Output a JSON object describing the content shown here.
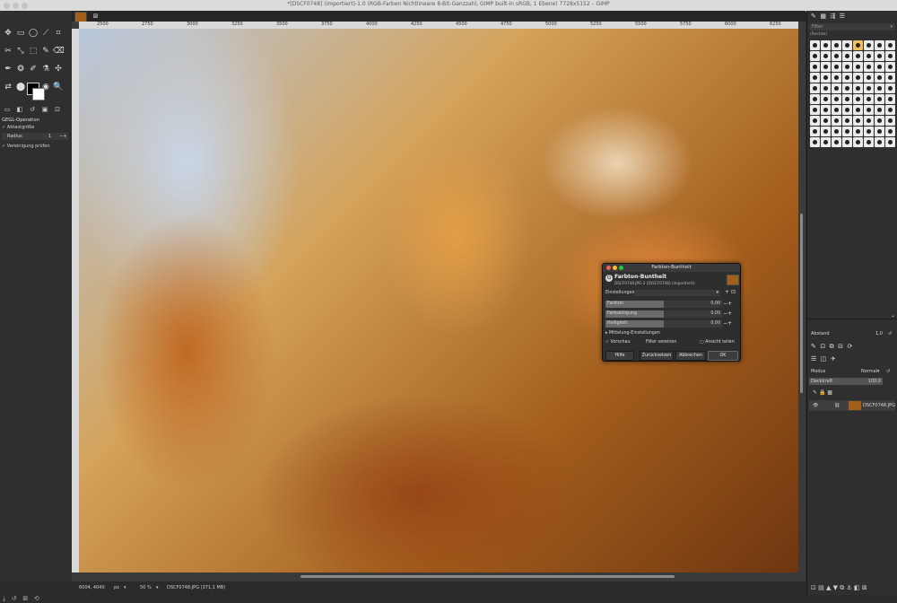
{
  "window": {
    "title": "*[DSCF0748] (importiert)-1.0 (RGB-Farben Nichtlineare 8-Bit-Ganzzahl, GIMP built-in sRGB, 1 Ebene) 7728x5152 – GIMP"
  },
  "toolbox": {
    "tools": [
      "✥",
      "▭",
      "◯",
      "⟋",
      "⌗",
      "✂",
      "⤡",
      "⬚",
      "✎",
      "⌫",
      "✒",
      "❂",
      "✐",
      "⚗",
      "✣",
      "⇄",
      "⬤",
      "⌖",
      "◉",
      "🔍"
    ],
    "option_title": "GEGL-Operation",
    "sample_label": "Abtastgröße",
    "radius_label": "Radius",
    "radius_value": "1",
    "merge_label": "Vereinigung prüfen"
  },
  "canvas": {
    "ruler_ticks": [
      "2500",
      "2750",
      "3000",
      "3250",
      "3500",
      "3750",
      "4000",
      "4250",
      "4500",
      "4750",
      "5000",
      "5250",
      "5500",
      "5750",
      "6000",
      "6250"
    ]
  },
  "status": {
    "coords": "6004, 4040",
    "unit": "px",
    "zoom": "50 %",
    "file": "DSCF0748.JPG (371,1 MB)"
  },
  "dialog": {
    "window_title": "Farbton-Buntheit",
    "heading": "Farbton-Buntheit",
    "subtitle": "DSCF0748.JPG-2 ([DSCF0748] (importiert))",
    "presets_label": "Einstellungen:",
    "sliders": [
      {
        "label": "Farbton",
        "value": "0,00",
        "fill": 0.5
      },
      {
        "label": "Farbsättigung",
        "value": "0,00",
        "fill": 0.5
      },
      {
        "label": "Helligkeit",
        "value": "0,00",
        "fill": 0.5
      }
    ],
    "blending_label": "Mittelung-Einstellungen",
    "preview_label": "Vorschau",
    "merge_filter_label": "Filter vereinen",
    "split_label": "Ansicht teilen",
    "buttons": {
      "help": "Hilfe",
      "reset": "Zurücksetzen",
      "cancel": "Abbrechen",
      "ok": "OK"
    }
  },
  "right_panel": {
    "filter_placeholder": "Filter",
    "brush_tag": "(Rechte)",
    "spacing_label": "Abstand",
    "spacing_value": "1,0",
    "mode_label": "Modus",
    "mode_value": "Normal",
    "opacity_label": "Deckkraft",
    "opacity_value": "100,0",
    "layer_name": "DSCF0748.JPG"
  },
  "colors": {
    "accent": "#a0601c",
    "panel": "#2f2f2f",
    "dialog": "#2e2e2e"
  }
}
